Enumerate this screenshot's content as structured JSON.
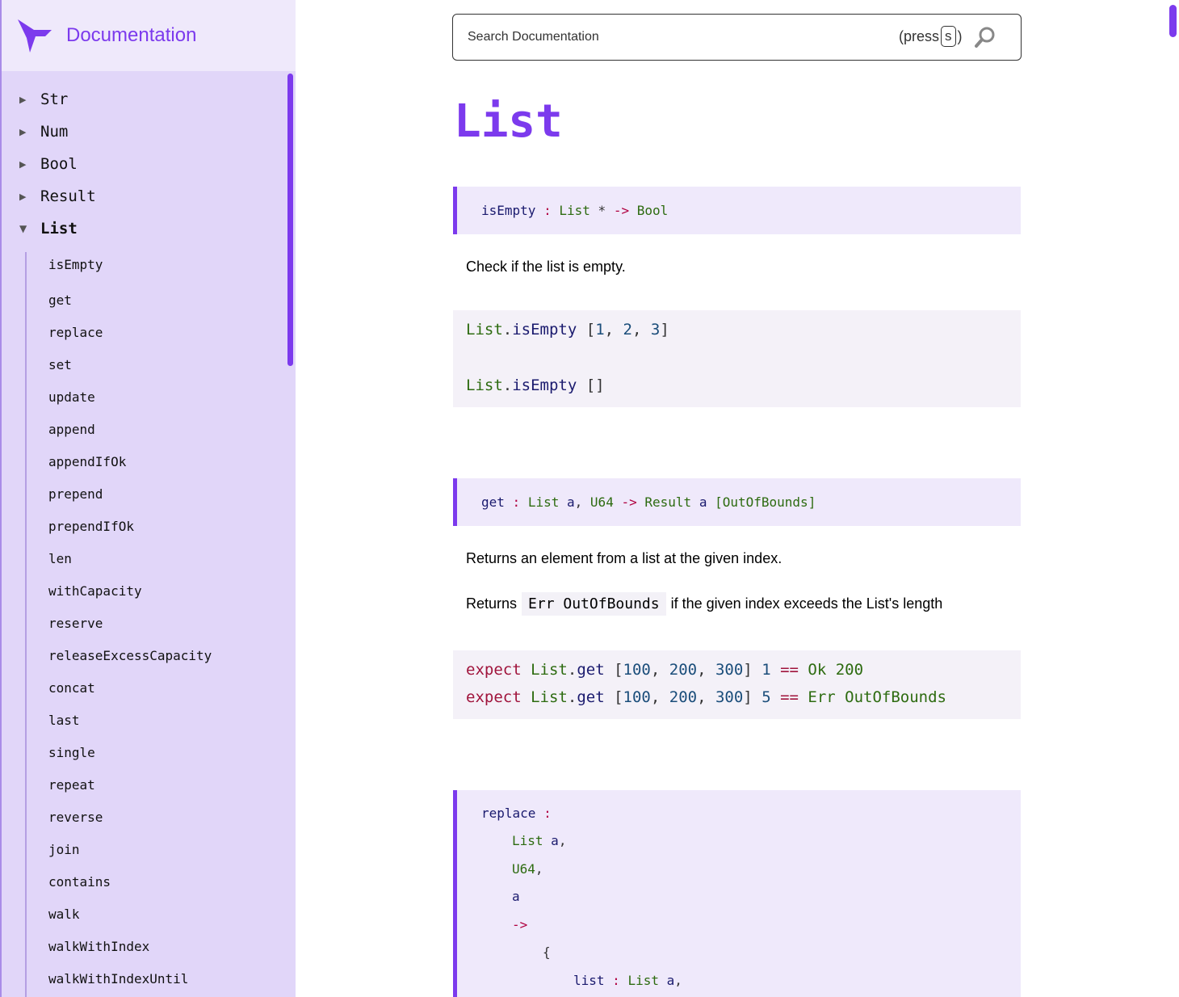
{
  "brand": {
    "title": "Documentation"
  },
  "search": {
    "placeholder": "Search Documentation",
    "press_open": "(press",
    "key": "s",
    "press_close": ")"
  },
  "sidebar": {
    "modules": [
      {
        "label": "Str",
        "expanded": false
      },
      {
        "label": "Num",
        "expanded": false
      },
      {
        "label": "Bool",
        "expanded": false
      },
      {
        "label": "Result",
        "expanded": false
      },
      {
        "label": "List",
        "expanded": true
      }
    ],
    "entries": [
      "isEmpty",
      "get",
      "replace",
      "set",
      "update",
      "append",
      "appendIfOk",
      "prepend",
      "prependIfOk",
      "len",
      "withCapacity",
      "reserve",
      "releaseExcessCapacity",
      "concat",
      "last",
      "single",
      "repeat",
      "reverse",
      "join",
      "contains",
      "walk",
      "walkWithIndex",
      "walkWithIndexUntil"
    ]
  },
  "page": {
    "title": "List"
  },
  "isEmpty": {
    "sig_name": "isEmpty",
    "sig_colon": ":",
    "sig_type1": "List",
    "sig_star": "*",
    "sig_arrow": "->",
    "sig_ret": "Bool",
    "description": "Check if the list is empty.",
    "example1": {
      "mod": "List",
      "dot": ".",
      "fn": "isEmpty",
      "open": " [",
      "n1": "1",
      "comma1": ", ",
      "n2": "2",
      "comma2": ", ",
      "n3": "3",
      "close": "]"
    },
    "example2": {
      "mod": "List",
      "dot": ".",
      "fn": "isEmpty",
      "rest": " []"
    }
  },
  "get": {
    "sig_name": "get",
    "sig_colon": ":",
    "sig_list": "List",
    "sig_a": "a",
    "sig_comma": ",",
    "sig_u64": "U64",
    "sig_arrow": "->",
    "sig_result": "Result",
    "sig_a2": "a",
    "sig_tag": "[OutOfBounds]",
    "description": "Returns an element from a list at the given index.",
    "desc2_before": "Returns",
    "desc2_code": "Err OutOfBounds",
    "desc2_after": "if the given index exceeds the List's length",
    "line1": {
      "kw": "expect",
      "mod": "List",
      "dot": ".",
      "fn": "get",
      "open": " [",
      "n1": "100",
      "c1": ", ",
      "n2": "200",
      "c2": ", ",
      "n3": "300",
      "close": "] ",
      "idx": "1",
      "eq": " == ",
      "res": "Ok 200"
    },
    "line2": {
      "kw": "expect",
      "mod": "List",
      "dot": ".",
      "fn": "get",
      "open": " [",
      "n1": "100",
      "c1": ", ",
      "n2": "200",
      "c2": ", ",
      "n3": "300",
      "close": "] ",
      "idx": "5",
      "eq": " == ",
      "res": "Err OutOfBounds"
    }
  },
  "replace": {
    "sig_name": "replace",
    "sig_colon": ":",
    "arg1_type": "List",
    "arg1_var": "a",
    "arg1_comma": ",",
    "arg2_type": "U64",
    "arg2_comma": ",",
    "arg3_var": "a",
    "arrow": "->",
    "brace": "{",
    "field1_name": "list",
    "field1_colon": ":",
    "field1_type": "List",
    "field1_var": "a",
    "field1_comma": ","
  }
}
